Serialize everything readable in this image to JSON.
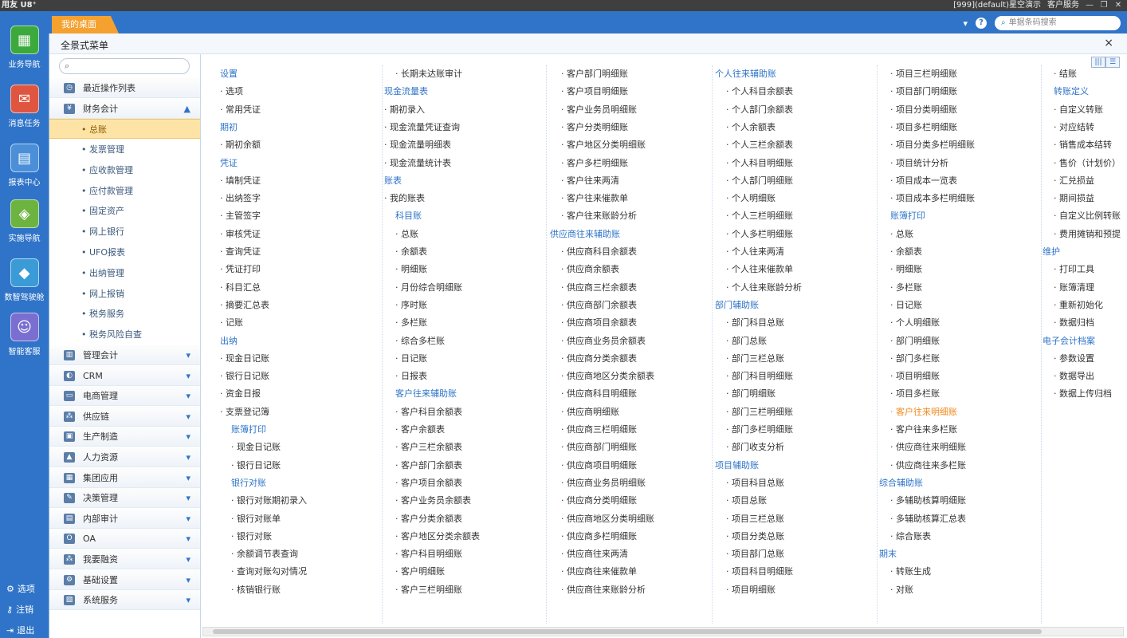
{
  "titlebar": {
    "brand": "用友 U8⁺",
    "account": "[999](default)星空演示",
    "service": "客户服务",
    "min": "—",
    "restore": "❐",
    "close": "✕"
  },
  "leftbar": {
    "items": [
      {
        "label": "业务导航",
        "icon": "grid-icon",
        "glyph": "▦"
      },
      {
        "label": "消息任务",
        "icon": "mail-icon",
        "glyph": "✉"
      },
      {
        "label": "报表中心",
        "icon": "report-icon",
        "glyph": "▤"
      },
      {
        "label": "实施导航",
        "icon": "compass-icon",
        "glyph": "◈"
      },
      {
        "label": "数智驾驶舱",
        "icon": "cube-icon",
        "glyph": "◆"
      },
      {
        "label": "智能客服",
        "icon": "robot-icon",
        "glyph": "☺"
      }
    ],
    "bottom": {
      "options": "选项",
      "logout": "注销",
      "exit": "退出"
    }
  },
  "tabrow": {
    "desktop_tab": "我的桌面",
    "search_placeholder": "单据条码搜索",
    "help": "?",
    "menu_arrow": "▾"
  },
  "panel": {
    "title": "全景式菜单",
    "close": "×"
  },
  "sidebar": {
    "search_icon": "⌕",
    "rows": [
      {
        "label": "最近操作列表",
        "icon": "clock-icon",
        "glyph": "◷",
        "arrow": ""
      },
      {
        "label": "财务会计",
        "icon": "yen-icon",
        "glyph": "¥",
        "arrow": "▲"
      }
    ],
    "finance_subitems": [
      "总账",
      "发票管理",
      "应收款管理",
      "应付款管理",
      "固定资产",
      "网上银行",
      "UFO报表",
      "出纳管理",
      "网上报销",
      "税务服务",
      "税务风险自查"
    ],
    "modules": [
      "管理会计",
      "CRM",
      "电商管理",
      "供应链",
      "生产制造",
      "人力资源",
      "集团应用",
      "决策管理",
      "内部审计",
      "OA",
      "我要融资",
      "基础设置",
      "系统服务"
    ],
    "module_arrow": "▾"
  },
  "content": {
    "columns": [
      [
        {
          "t": "设置",
          "k": "hd"
        },
        {
          "t": "· 选项"
        },
        {
          "t": "· 常用凭证"
        },
        {
          "t": "期初",
          "k": "hd"
        },
        {
          "t": "· 期初余额"
        },
        {
          "t": "凭证",
          "k": "hd"
        },
        {
          "t": "· 填制凭证"
        },
        {
          "t": "· 出纳签字"
        },
        {
          "t": "· 主管签字"
        },
        {
          "t": "· 审核凭证"
        },
        {
          "t": "· 查询凭证"
        },
        {
          "t": "· 凭证打印"
        },
        {
          "t": "· 科目汇总"
        },
        {
          "t": "· 摘要汇总表"
        },
        {
          "t": "· 记账"
        },
        {
          "t": "出纳",
          "k": "hd"
        },
        {
          "t": "· 现金日记账"
        },
        {
          "t": "· 银行日记账"
        },
        {
          "t": "· 资金日报"
        },
        {
          "t": "· 支票登记簿"
        },
        {
          "t": "账簿打印",
          "k": "hd",
          "i": 1
        },
        {
          "t": "· 现金日记账",
          "i": 1
        },
        {
          "t": "· 银行日记账",
          "i": 1
        },
        {
          "t": "银行对账",
          "k": "hd",
          "i": 1
        },
        {
          "t": "· 银行对账期初录入",
          "i": 1
        },
        {
          "t": "· 银行对账单",
          "i": 1
        },
        {
          "t": "· 银行对账",
          "i": 1
        },
        {
          "t": "· 余额调节表查询",
          "i": 1
        },
        {
          "t": "· 查询对账勾对情况",
          "i": 1
        },
        {
          "t": "· 核销银行账",
          "i": 1
        }
      ],
      [
        {
          "t": "· 长期未达账审计",
          "i": 1
        },
        {
          "t": "现金流量表",
          "k": "hd"
        },
        {
          "t": "· 期初录入"
        },
        {
          "t": "· 现金流量凭证查询"
        },
        {
          "t": "· 现金流量明细表"
        },
        {
          "t": "· 现金流量统计表"
        },
        {
          "t": "账表",
          "k": "hd"
        },
        {
          "t": "· 我的账表"
        },
        {
          "t": "科目账",
          "k": "hd",
          "i": 1
        },
        {
          "t": "· 总账",
          "i": 1
        },
        {
          "t": "· 余额表",
          "i": 1
        },
        {
          "t": "· 明细账",
          "i": 1
        },
        {
          "t": "· 月份综合明细账",
          "i": 1
        },
        {
          "t": "· 序时账",
          "i": 1
        },
        {
          "t": "· 多栏账",
          "i": 1
        },
        {
          "t": "· 综合多栏账",
          "i": 1
        },
        {
          "t": "· 日记账",
          "i": 1
        },
        {
          "t": "· 日报表",
          "i": 1
        },
        {
          "t": "客户往来辅助账",
          "k": "hd",
          "i": 1
        },
        {
          "t": "· 客户科目余额表",
          "i": 1
        },
        {
          "t": "· 客户余额表",
          "i": 1
        },
        {
          "t": "· 客户三栏余额表",
          "i": 1
        },
        {
          "t": "· 客户部门余额表",
          "i": 1
        },
        {
          "t": "· 客户项目余额表",
          "i": 1
        },
        {
          "t": "· 客户业务员余额表",
          "i": 1
        },
        {
          "t": "· 客户分类余额表",
          "i": 1
        },
        {
          "t": "· 客户地区分类余额表",
          "i": 1
        },
        {
          "t": "· 客户科目明细账",
          "i": 1
        },
        {
          "t": "· 客户明细账",
          "i": 1
        },
        {
          "t": "· 客户三栏明细账",
          "i": 1
        }
      ],
      [
        {
          "t": "· 客户部门明细账",
          "i": 1
        },
        {
          "t": "· 客户项目明细账",
          "i": 1
        },
        {
          "t": "· 客户业务员明细账",
          "i": 1
        },
        {
          "t": "· 客户分类明细账",
          "i": 1
        },
        {
          "t": "· 客户地区分类明细账",
          "i": 1
        },
        {
          "t": "· 客户多栏明细账",
          "i": 1
        },
        {
          "t": "· 客户往来两清",
          "i": 1
        },
        {
          "t": "· 客户往来催款单",
          "i": 1
        },
        {
          "t": "· 客户往来账龄分析",
          "i": 1
        },
        {
          "t": "供应商往来辅助账",
          "k": "hd"
        },
        {
          "t": "· 供应商科目余额表",
          "i": 1
        },
        {
          "t": "· 供应商余额表",
          "i": 1
        },
        {
          "t": "· 供应商三栏余额表",
          "i": 1
        },
        {
          "t": "· 供应商部门余额表",
          "i": 1
        },
        {
          "t": "· 供应商项目余额表",
          "i": 1
        },
        {
          "t": "· 供应商业务员余额表",
          "i": 1
        },
        {
          "t": "· 供应商分类余额表",
          "i": 1
        },
        {
          "t": "· 供应商地区分类余额表",
          "i": 1
        },
        {
          "t": "· 供应商科目明细账",
          "i": 1
        },
        {
          "t": "· 供应商明细账",
          "i": 1
        },
        {
          "t": "· 供应商三栏明细账",
          "i": 1
        },
        {
          "t": "· 供应商部门明细账",
          "i": 1
        },
        {
          "t": "· 供应商项目明细账",
          "i": 1
        },
        {
          "t": "· 供应商业务员明细账",
          "i": 1
        },
        {
          "t": "· 供应商分类明细账",
          "i": 1
        },
        {
          "t": "· 供应商地区分类明细账",
          "i": 1
        },
        {
          "t": "· 供应商多栏明细账",
          "i": 1
        },
        {
          "t": "· 供应商往来两清",
          "i": 1
        },
        {
          "t": "· 供应商往来催款单",
          "i": 1
        },
        {
          "t": "· 供应商往来账龄分析",
          "i": 1
        }
      ],
      [
        {
          "t": "个人往来辅助账",
          "k": "hd"
        },
        {
          "t": "· 个人科目余额表",
          "i": 1
        },
        {
          "t": "· 个人部门余额表",
          "i": 1
        },
        {
          "t": "· 个人余额表",
          "i": 1
        },
        {
          "t": "· 个人三栏余额表",
          "i": 1
        },
        {
          "t": "· 个人科目明细账",
          "i": 1
        },
        {
          "t": "· 个人部门明细账",
          "i": 1
        },
        {
          "t": "· 个人明细账",
          "i": 1
        },
        {
          "t": "· 个人三栏明细账",
          "i": 1
        },
        {
          "t": "· 个人多栏明细账",
          "i": 1
        },
        {
          "t": "· 个人往来两清",
          "i": 1
        },
        {
          "t": "· 个人往来催款单",
          "i": 1
        },
        {
          "t": "· 个人往来账龄分析",
          "i": 1
        },
        {
          "t": "部门辅助账",
          "k": "hd"
        },
        {
          "t": "· 部门科目总账",
          "i": 1
        },
        {
          "t": "· 部门总账",
          "i": 1
        },
        {
          "t": "· 部门三栏总账",
          "i": 1
        },
        {
          "t": "· 部门科目明细账",
          "i": 1
        },
        {
          "t": "· 部门明细账",
          "i": 1
        },
        {
          "t": "· 部门三栏明细账",
          "i": 1
        },
        {
          "t": "· 部门多栏明细账",
          "i": 1
        },
        {
          "t": "· 部门收支分析",
          "i": 1
        },
        {
          "t": "项目辅助账",
          "k": "hd"
        },
        {
          "t": "· 项目科目总账",
          "i": 1
        },
        {
          "t": "· 项目总账",
          "i": 1
        },
        {
          "t": "· 项目三栏总账",
          "i": 1
        },
        {
          "t": "· 项目分类总账",
          "i": 1
        },
        {
          "t": "· 项目部门总账",
          "i": 1
        },
        {
          "t": "· 项目科目明细账",
          "i": 1
        },
        {
          "t": "· 项目明细账",
          "i": 1
        }
      ],
      [
        {
          "t": "· 项目三栏明细账",
          "i": 1
        },
        {
          "t": "· 项目部门明细账",
          "i": 1
        },
        {
          "t": "· 项目分类明细账",
          "i": 1
        },
        {
          "t": "· 项目多栏明细账",
          "i": 1
        },
        {
          "t": "· 项目分类多栏明细账",
          "i": 1
        },
        {
          "t": "· 项目统计分析",
          "i": 1
        },
        {
          "t": "· 项目成本一览表",
          "i": 1
        },
        {
          "t": "· 项目成本多栏明细账",
          "i": 1
        },
        {
          "t": "账簿打印",
          "k": "hd",
          "i": 1
        },
        {
          "t": "· 总账",
          "i": 1
        },
        {
          "t": "· 余额表",
          "i": 1
        },
        {
          "t": "· 明细账",
          "i": 1
        },
        {
          "t": "· 多栏账",
          "i": 1
        },
        {
          "t": "· 日记账",
          "i": 1
        },
        {
          "t": "· 个人明细账",
          "i": 1
        },
        {
          "t": "· 部门明细账",
          "i": 1
        },
        {
          "t": "· 部门多栏账",
          "i": 1
        },
        {
          "t": "· 项目明细账",
          "i": 1
        },
        {
          "t": "· 项目多栏账",
          "i": 1
        },
        {
          "t": "· 客户往来明细账",
          "i": 1,
          "k": "hl"
        },
        {
          "t": "· 客户往来多栏账",
          "i": 1
        },
        {
          "t": "· 供应商往来明细账",
          "i": 1
        },
        {
          "t": "· 供应商往来多栏账",
          "i": 1
        },
        {
          "t": "综合辅助账",
          "k": "hd"
        },
        {
          "t": "· 多辅助核算明细账",
          "i": 1
        },
        {
          "t": "· 多辅助核算汇总表",
          "i": 1
        },
        {
          "t": "· 综合账表",
          "i": 1
        },
        {
          "t": "期末",
          "k": "hd"
        },
        {
          "t": "· 转账生成",
          "i": 1
        },
        {
          "t": "· 对账",
          "i": 1
        }
      ],
      [
        {
          "t": "· 结账",
          "i": 1
        },
        {
          "t": "转账定义",
          "k": "hd",
          "i": 1
        },
        {
          "t": "· 自定义转账",
          "i": 1
        },
        {
          "t": "· 对应结转",
          "i": 1
        },
        {
          "t": "· 销售成本结转",
          "i": 1
        },
        {
          "t": "· 售价（计划价）",
          "i": 1
        },
        {
          "t": "· 汇兑损益",
          "i": 1
        },
        {
          "t": "· 期间损益",
          "i": 1
        },
        {
          "t": "· 自定义比例转账",
          "i": 1
        },
        {
          "t": "· 费用摊销和预提",
          "i": 1
        },
        {
          "t": "维护",
          "k": "hd"
        },
        {
          "t": "· 打印工具",
          "i": 1
        },
        {
          "t": "· 账簿清理",
          "i": 1
        },
        {
          "t": "· 重新初始化",
          "i": 1
        },
        {
          "t": "· 数据归档",
          "i": 1
        },
        {
          "t": "电子会计档案",
          "k": "hd"
        },
        {
          "t": "· 参数设置",
          "i": 1
        },
        {
          "t": "· 数据导出",
          "i": 1
        },
        {
          "t": "· 数据上传归档",
          "i": 1
        }
      ]
    ]
  }
}
